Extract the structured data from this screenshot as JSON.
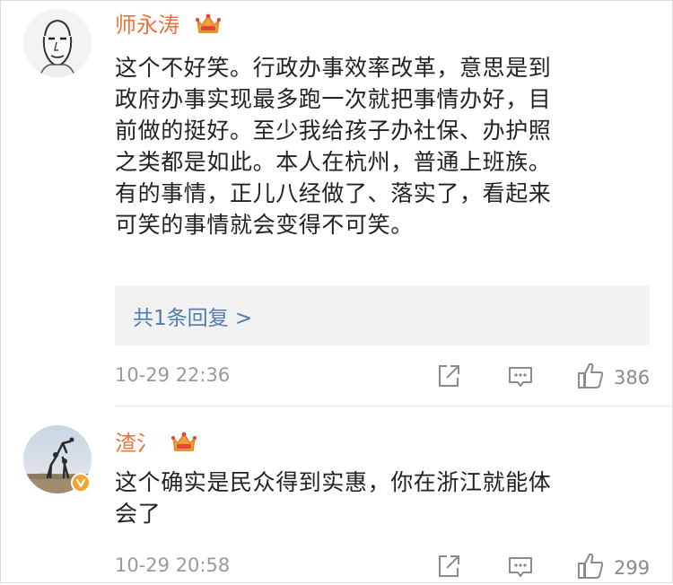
{
  "comments": [
    {
      "username": "师永涛",
      "text_lines": [
        "这个不好笑。行政办事效率改革，意思是到",
        "政府办事实现最多跑一次就把事情办好，目",
        "前做的挺好。至少我给孩子办社保、办护照",
        "之类都是如此。本人在杭州，普通上班族。",
        "有的事情，正儿八经做了、落实了，看起来",
        "可笑的事情就会变得不可笑。"
      ],
      "reply_link": "共1条回复 >",
      "timestamp": "10-29 22:36",
      "likes": "386"
    },
    {
      "username": "渣氵",
      "text_lines": [
        "这个确实是民众得到实惠，你在浙江就能体",
        "会了"
      ],
      "timestamp": "10-29 20:58",
      "likes": "299"
    }
  ],
  "colors": {
    "username": "#eb7340",
    "link": "#507daf",
    "meta": "#9a9a9a",
    "reply_bg": "#f2f2f2",
    "vip_gold": "#f0a23a"
  }
}
